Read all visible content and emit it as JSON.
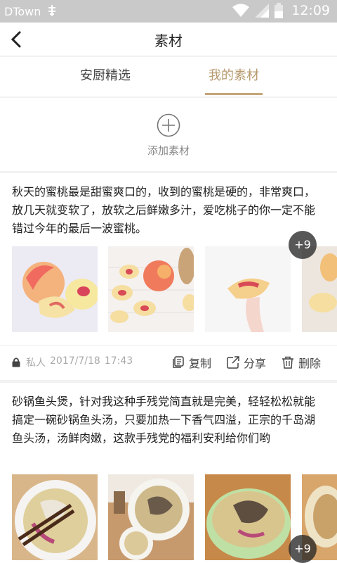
{
  "status_bar": {
    "carrier": "DTown",
    "time": "12:09",
    "icons": [
      "signal-extra-icon",
      "wifi-icon",
      "cell-signal-icon",
      "battery-icon"
    ]
  },
  "header": {
    "title": "素材",
    "back_icon": "back-arrow-icon"
  },
  "tabs": [
    {
      "label": "安厨精选",
      "active": false
    },
    {
      "label": "我的素材",
      "active": true
    }
  ],
  "add_material": {
    "label": "添加素材",
    "icon": "add-circle-icon"
  },
  "posts": [
    {
      "text": "秋天的蜜桃最是甜蜜爽口的，收到的蜜桃是硬的，非常爽口，放几天就变软了，放软之后鲜嫩多汁，爱吃桃子的你一定不能错过今年的最后一波蜜桃。",
      "images": [
        "peach-photo-1",
        "peach-photo-2",
        "peach-photo-3",
        "peach-photo-4"
      ],
      "more_count": "+9",
      "privacy": "私人",
      "date": "2017/7/18",
      "time": "17:43",
      "actions": {
        "copy": "复制",
        "share": "分享",
        "delete": "删除"
      }
    },
    {
      "text": "砂锅鱼头煲，针对我这种手残党简直就是完美，轻轻松松就能搞定一碗砂锅鱼头汤，只要加热一下香气四溢，正宗的千岛湖鱼头汤，汤鲜肉嫩，这款手残党的福利安利给你们哟",
      "images": [
        "fish-soup-photo-1",
        "fish-soup-photo-2",
        "fish-soup-photo-3",
        "fish-soup-photo-4"
      ],
      "more_count": "+9"
    }
  ],
  "colors": {
    "accent": "#b79a6e",
    "status_bar": "#c9c9c9",
    "background": "#f2f2f2"
  }
}
